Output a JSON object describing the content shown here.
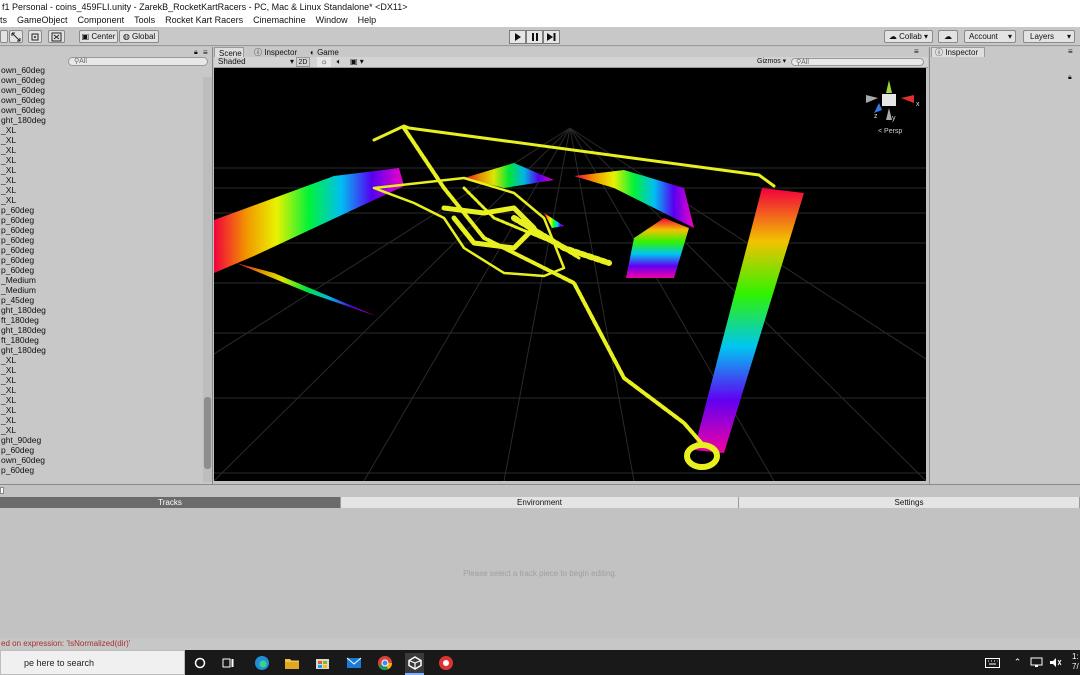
{
  "window": {
    "title": "f1 Personal - coins_459FLI.unity - ZarekB_RocketKartRacers - PC, Mac & Linux Standalone* <DX11>"
  },
  "menu": [
    "ts",
    "GameObject",
    "Component",
    "Tools",
    "Rocket Kart Racers",
    "Cinemachine",
    "Window",
    "Help"
  ],
  "toolbar": {
    "center": "Center",
    "global": "Global",
    "collab": "Collab ▾",
    "account": "Account",
    "layers": "Layers"
  },
  "hierarchy": {
    "search_placeholder": "All",
    "items": [
      "own_60deg",
      "own_60deg",
      "own_60deg",
      "own_60deg",
      "own_60deg",
      "ght_180deg",
      "_XL",
      "_XL",
      "_XL",
      "_XL",
      "_XL",
      "_XL",
      "_XL",
      "_XL",
      "p_60deg",
      "p_60deg",
      "p_60deg",
      "p_60deg",
      "p_60deg",
      "p_60deg",
      "p_60deg",
      "_Medium",
      "_Medium",
      "p_45deg",
      "ght_180deg",
      "ft_180deg",
      "ght_180deg",
      "ft_180deg",
      "ght_180deg",
      "_XL",
      "_XL",
      "_XL",
      "_XL",
      "_XL",
      "_XL",
      "_XL",
      "_XL",
      "ght_90deg",
      "p_60deg",
      "own_60deg",
      "p_60deg"
    ]
  },
  "scene": {
    "tabs": [
      {
        "label": "Scene"
      },
      {
        "label": "Inspector"
      },
      {
        "label": "Game"
      }
    ],
    "shading_mode": "Shaded",
    "mode_2d": "2D",
    "gizmos": "Gizmos",
    "search_placeholder": "All",
    "persp_label": "< Persp",
    "axes": {
      "x": "x",
      "y": "y",
      "z": "z"
    }
  },
  "inspector": {
    "title": "Inspector"
  },
  "track_editor": {
    "tabs": [
      "Tracks",
      "Environment",
      "Settings"
    ],
    "message": "Please select a track piece to begin editing."
  },
  "status": {
    "message": "ed on expression: 'IsNormalized(dir)'"
  },
  "taskbar": {
    "search_placeholder": "pe here to search",
    "clock_time": "1:",
    "clock_date": "7/"
  },
  "colors": {
    "accent_yellow": "#e8f020",
    "scene_bg": "#000000",
    "editor_bg": "#c2c2c2"
  }
}
